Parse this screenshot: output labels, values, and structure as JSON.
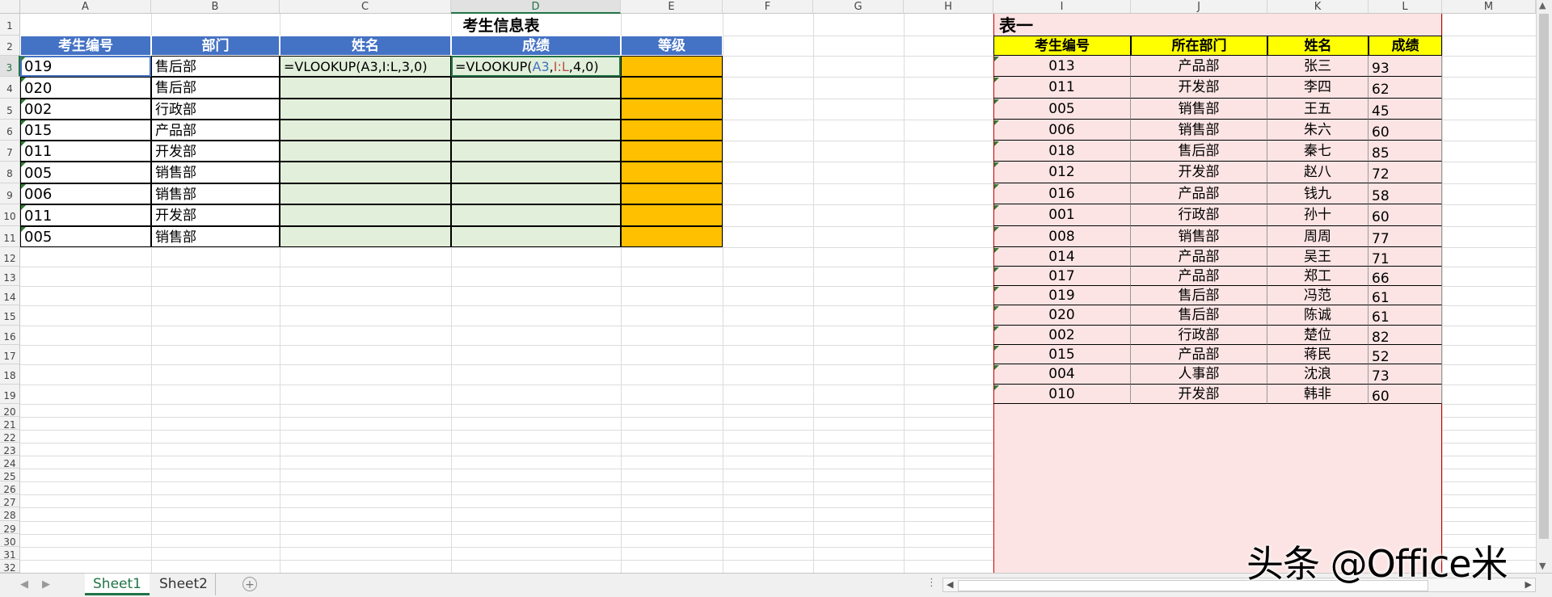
{
  "columns": [
    "A",
    "B",
    "C",
    "D",
    "E",
    "F",
    "G",
    "H",
    "I",
    "J",
    "K",
    "L",
    "M"
  ],
  "rows": [
    "1",
    "2",
    "3",
    "4",
    "5",
    "6",
    "7",
    "8",
    "9",
    "10",
    "11",
    "12",
    "13",
    "14",
    "15",
    "16",
    "17",
    "18",
    "19",
    "20",
    "21",
    "22",
    "23",
    "24",
    "25",
    "26",
    "27",
    "28",
    "29",
    "30",
    "31",
    "32"
  ],
  "left_table": {
    "title": "考生信息表",
    "headers": [
      "考生编号",
      "部门",
      "姓名",
      "成绩",
      "等级"
    ],
    "formula_c3": "=VLOOKUP(A3,I:L,3,0)",
    "formula_d3": {
      "p1": "=VLOOKUP(",
      "p2": "A3",
      "p3": ",",
      "p4": "I:L",
      "p5": ",4,0)"
    },
    "rows": [
      {
        "id": "019",
        "dept": "售后部"
      },
      {
        "id": "020",
        "dept": "售后部"
      },
      {
        "id": "002",
        "dept": "行政部"
      },
      {
        "id": "015",
        "dept": "产品部"
      },
      {
        "id": "011",
        "dept": "开发部"
      },
      {
        "id": "005",
        "dept": "销售部"
      },
      {
        "id": "006",
        "dept": "销售部"
      },
      {
        "id": "011",
        "dept": "开发部"
      },
      {
        "id": "005",
        "dept": "销售部"
      }
    ]
  },
  "right_table": {
    "title": "表一",
    "headers": [
      "考生编号",
      "所在部门",
      "姓名",
      "成绩"
    ],
    "rows": [
      {
        "id": "013",
        "dept": "产品部",
        "name": "张三",
        "score": "93"
      },
      {
        "id": "011",
        "dept": "开发部",
        "name": "李四",
        "score": "62"
      },
      {
        "id": "005",
        "dept": "销售部",
        "name": "王五",
        "score": "45"
      },
      {
        "id": "006",
        "dept": "销售部",
        "name": "朱六",
        "score": "60"
      },
      {
        "id": "018",
        "dept": "售后部",
        "name": "秦七",
        "score": "85"
      },
      {
        "id": "012",
        "dept": "开发部",
        "name": "赵八",
        "score": "72"
      },
      {
        "id": "016",
        "dept": "产品部",
        "name": "钱九",
        "score": "58"
      },
      {
        "id": "001",
        "dept": "行政部",
        "name": "孙十",
        "score": "60"
      },
      {
        "id": "008",
        "dept": "销售部",
        "name": "周周",
        "score": "77"
      },
      {
        "id": "014",
        "dept": "产品部",
        "name": "吴王",
        "score": "71"
      },
      {
        "id": "017",
        "dept": "产品部",
        "name": "郑工",
        "score": "66"
      },
      {
        "id": "019",
        "dept": "售后部",
        "name": "冯范",
        "score": "61"
      },
      {
        "id": "020",
        "dept": "售后部",
        "name": "陈诚",
        "score": "61"
      },
      {
        "id": "002",
        "dept": "行政部",
        "name": "楚位",
        "score": "82"
      },
      {
        "id": "015",
        "dept": "产品部",
        "name": "蒋民",
        "score": "52"
      },
      {
        "id": "004",
        "dept": "人事部",
        "name": "沈浪",
        "score": "73"
      },
      {
        "id": "010",
        "dept": "开发部",
        "name": "韩非",
        "score": "60"
      }
    ]
  },
  "tabs": [
    "Sheet1",
    "Sheet2"
  ],
  "active_tab": "Sheet1",
  "watermark": "头条 @Office米",
  "colors": {
    "header_blue": "#4472c4",
    "input_green": "#e2efda",
    "grade_orange": "#ffc000",
    "header_yellow": "#ffff00",
    "pink_fill": "#fce4e4",
    "excel_green": "#217346"
  }
}
